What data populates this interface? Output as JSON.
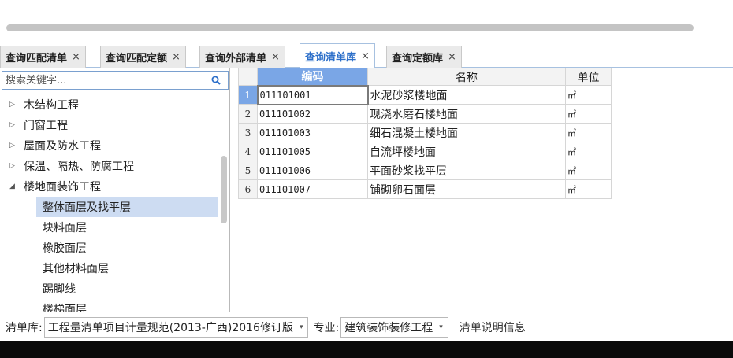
{
  "tabs": [
    {
      "label": "查询匹配清单",
      "close": "×"
    },
    {
      "label": "查询匹配定额",
      "close": "×"
    },
    {
      "label": "查询外部清单",
      "close": "×"
    },
    {
      "label": "查询清单库",
      "close": "×",
      "active": true
    },
    {
      "label": "查询定额库",
      "close": "×"
    }
  ],
  "search": {
    "placeholder": "搜索关键字..."
  },
  "tree": {
    "items": [
      {
        "label": "木结构工程",
        "arrow": "▷"
      },
      {
        "label": "门窗工程",
        "arrow": "▷"
      },
      {
        "label": "屋面及防水工程",
        "arrow": "▷"
      },
      {
        "label": "保温、隔热、防腐工程",
        "arrow": "▷"
      },
      {
        "label": "楼地面装饰工程",
        "arrow": "◢"
      },
      {
        "label": "整体面层及找平层"
      },
      {
        "label": "块料面层"
      },
      {
        "label": "橡胶面层"
      },
      {
        "label": "其他材料面层"
      },
      {
        "label": "踢脚线"
      },
      {
        "label": "楼梯面层"
      }
    ]
  },
  "table": {
    "headers": {
      "code": "编码",
      "name": "名称",
      "unit": "单位"
    },
    "rows": [
      {
        "idx": "1",
        "code": "011101001",
        "name": "水泥砂浆楼地面",
        "unit": "㎡"
      },
      {
        "idx": "2",
        "code": "011101002",
        "name": "现浇水磨石楼地面",
        "unit": "㎡"
      },
      {
        "idx": "3",
        "code": "011101003",
        "name": "细石混凝土楼地面",
        "unit": "㎡"
      },
      {
        "idx": "4",
        "code": "011101005",
        "name": "自流坪楼地面",
        "unit": "㎡"
      },
      {
        "idx": "5",
        "code": "011101006",
        "name": "平面砂浆找平层",
        "unit": "㎡"
      },
      {
        "idx": "6",
        "code": "011101007",
        "name": "铺砌卵石面层",
        "unit": "㎡"
      }
    ]
  },
  "bottom": {
    "library_label": "清单库:",
    "library_value": "工程量清单项目计量规范(2013-广西)2016修订版",
    "profession_label": "专业:",
    "profession_value": "建筑装饰装修工程",
    "info_label": "清单说明信息",
    "dropdown": "▾"
  },
  "colors": {
    "accent": "#7aa6e6",
    "selected": "#cddcf2",
    "active_tab_text": "#2b6ec9"
  }
}
